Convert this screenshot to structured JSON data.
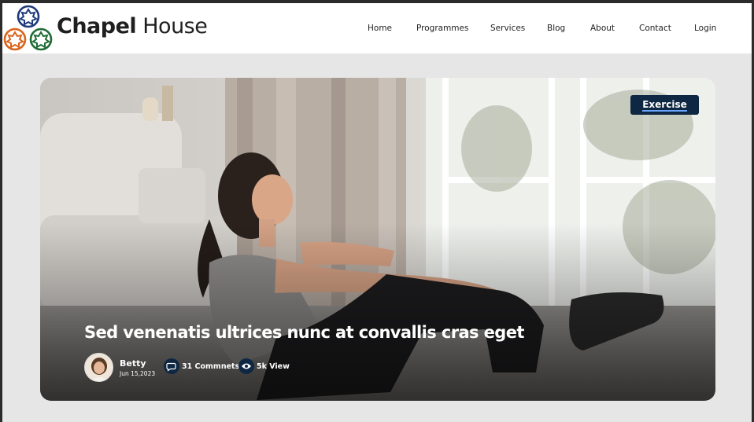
{
  "brand": {
    "name_bold": "Chapel",
    "name_light": "House"
  },
  "nav": {
    "items": [
      "Home",
      "Programmes",
      "Services",
      "Blog",
      "About",
      "Contact",
      "Login"
    ]
  },
  "hero": {
    "category": "Exercise",
    "title": "Sed venenatis ultrices nunc at convallis cras eget",
    "author": "Betty",
    "date": "Jun 15,2023",
    "comments": "31 Commnets",
    "views": "5k  View"
  },
  "colors": {
    "logo_blue": "#1f3a7a",
    "logo_orange": "#d9641c",
    "logo_green": "#1e6b34",
    "tag_bg": "#0e2742"
  }
}
